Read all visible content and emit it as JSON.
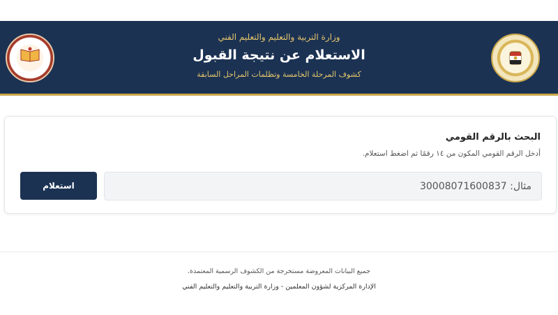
{
  "header": {
    "ministry": "وزارة التربية والتعليم والتعليم الفني",
    "title": "الاستعلام عن نتيجة القبول",
    "subtitle": "كشوف المرحلة الخامسة وتظلمات المراحل السابقة"
  },
  "search": {
    "title": "البحث بالرقم القومي",
    "hint": "أدخل الرقم القومي المكون من ١٤ رقمًا ثم اضغط استعلام.",
    "placeholder": "مثال: 30008071600837",
    "button_label": "استعلام"
  },
  "footer": {
    "line1": "جميع البيانات المعروضة مستخرجة من الكشوف الرسمية المعتمدة.",
    "line2": "الإدارة المركزية لشؤون المعلمين - وزارة التربية والتعليم والتعليم الفني"
  },
  "colors": {
    "header_bg": "#1b3253",
    "accent_gold": "#c9a64a",
    "button_bg": "#1b3253"
  },
  "icons": {
    "right_logo": "ministry-seal-icon",
    "left_logo": "teachers-affairs-logo-icon"
  }
}
